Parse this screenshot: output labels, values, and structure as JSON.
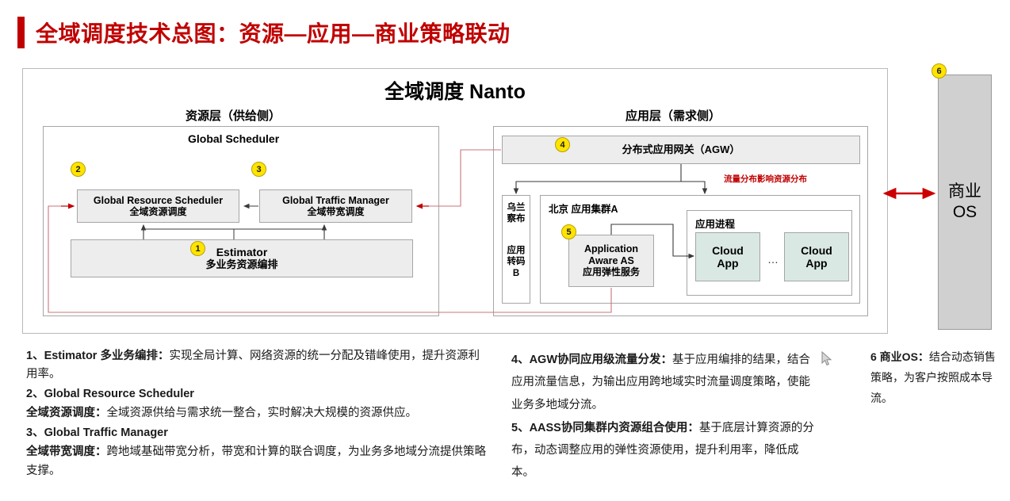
{
  "title": {
    "text": "全域调度技术总图：资源—应用—商业策略联动",
    "accent_color": "#c00000"
  },
  "diagram": {
    "main_title": "全域调度  Nanto",
    "left_layer_caption": "资源层（供给侧）",
    "right_layer_caption": "应用层（需求侧）",
    "global_scheduler_label": "Global Scheduler",
    "boxes": {
      "grs": {
        "en": "Global Resource  Scheduler",
        "cn": "全域资源调度",
        "badge": "2"
      },
      "gtm": {
        "en": "Global Traffic Manager",
        "cn": "全域带宽调度",
        "badge": "3"
      },
      "estimator": {
        "en": "Estimator",
        "cn": "多业务资源编排",
        "badge": "1"
      },
      "agw": {
        "cn": "分布式应用网关（AGW）",
        "badge": "4"
      },
      "wulanchabu": {
        "line1": "乌兰",
        "line2": "察布",
        "line3": "应用",
        "line4": "转码",
        "line5": "B"
      },
      "cluster_a": {
        "label": "北京  应用集群A"
      },
      "app_process": {
        "label": "应用进程"
      },
      "aas": {
        "en1": "Application",
        "en2": "Aware AS",
        "cn": "应用弹性服务",
        "badge": "5"
      },
      "cloud_app_1": {
        "line1": "Cloud",
        "line2": "App"
      },
      "cloud_app_2": {
        "line1": "Cloud",
        "line2": "App"
      },
      "ellipsis": "…"
    },
    "red_annotation": "流量分布影响资源分布"
  },
  "commercial_os": {
    "line1": "商业",
    "line2": "OS",
    "badge": "6"
  },
  "notes": {
    "column1": [
      {
        "bold": "1、Estimator 多业务编排：",
        "rest": "实现全局计算、网络资源的统一分配及错峰使用，提升资源利用率。"
      },
      {
        "bold": "2、Global Resource  Scheduler",
        "rest": ""
      },
      {
        "bold": "全域资源调度：",
        "rest": "全域资源供给与需求统一整合，实时解决大规模的资源供应。"
      },
      {
        "bold": "3、Global Traffic Manager",
        "rest": ""
      },
      {
        "bold": "全域带宽调度：",
        "rest": "跨地域基础带宽分析，带宽和计算的联合调度，为业务多地域分流提供策略支撑。"
      }
    ],
    "column2": [
      {
        "bold": "4、AGW协同应用级流量分发：",
        "rest": "基于应用编排的结果，结合应用流量信息，为输出应用跨地域实时流量调度策略，使能业务多地域分流。"
      },
      {
        "bold": "5、AASS协同集群内资源组合使用：",
        "rest": "基于底层计算资源的分布，动态调整应用的弹性资源使用，提升利用率，降低成本。"
      }
    ],
    "column3": [
      {
        "bold": "6 商业OS：",
        "rest": "结合动态销售策略，为客户按照成本导流。"
      }
    ]
  },
  "colors": {
    "accent_red": "#c00000",
    "badge_yellow": "#ffe400",
    "box_gray": "#ededed",
    "cloud_app_mint": "#d9e8e2",
    "os_gray": "#d0d0d0"
  }
}
